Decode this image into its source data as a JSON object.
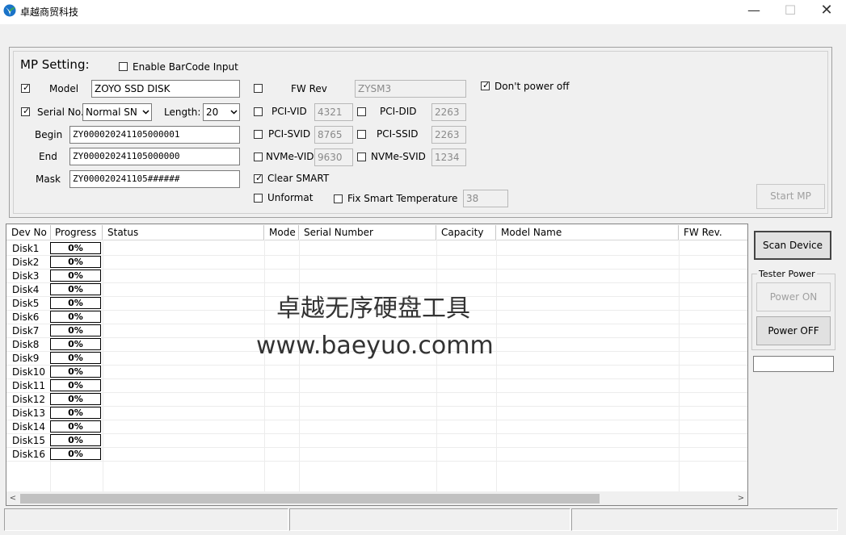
{
  "window": {
    "title": "卓越商贸科技",
    "minimize_glyph": "—",
    "maximize_glyph": "☐",
    "close_glyph": "✕",
    "icon": "app-logo-icon"
  },
  "mp_setting": {
    "label": "MP Setting:",
    "enable_barcode": {
      "label": "Enable BarCode Input",
      "checked": false
    },
    "model": {
      "label": "Model",
      "checked": true,
      "value": "ZOYO SSD DISK"
    },
    "serial": {
      "label": "Serial No.",
      "checked": true,
      "mode": "Normal SN",
      "length_label": "Length:",
      "length": "20"
    },
    "begin": {
      "label": "Begin",
      "value": "ZY000020241105000001"
    },
    "end": {
      "label": "End",
      "value": "ZY000020241105000000"
    },
    "mask": {
      "label": "Mask",
      "value": "ZY000020241105######"
    },
    "fw_rev": {
      "label": "FW Rev",
      "checked": false,
      "value": "ZYSM3"
    },
    "pci_vid": {
      "label": "PCI-VID",
      "checked": false,
      "value": "4321"
    },
    "pci_did": {
      "label": "PCI-DID",
      "checked": false,
      "value": "2263"
    },
    "pci_svid": {
      "label": "PCI-SVID",
      "checked": false,
      "value": "8765"
    },
    "pci_ssid": {
      "label": "PCI-SSID",
      "checked": false,
      "value": "2263"
    },
    "nvme_vid": {
      "label": "NVMe-VID",
      "checked": false,
      "value": "9630"
    },
    "nvme_svid": {
      "label": "NVMe-SVID",
      "checked": false,
      "value": "1234"
    },
    "clear_smart": {
      "label": "Clear SMART",
      "checked": true
    },
    "unformat": {
      "label": "Unformat",
      "checked": false
    },
    "fix_smart_temp": {
      "label": "Fix Smart Temperature",
      "checked": false,
      "value": "38"
    },
    "dont_power_off": {
      "label": "Don't power off",
      "checked": true
    },
    "start_mp": "Start MP"
  },
  "device_list": {
    "columns": [
      "Dev No",
      "Progress",
      "Status",
      "Mode",
      "Serial Number",
      "Capacity",
      "Model Name",
      "FW Rev."
    ],
    "rows": [
      {
        "dev": "Disk1",
        "progress": "0%"
      },
      {
        "dev": "Disk2",
        "progress": "0%"
      },
      {
        "dev": "Disk3",
        "progress": "0%"
      },
      {
        "dev": "Disk4",
        "progress": "0%"
      },
      {
        "dev": "Disk5",
        "progress": "0%"
      },
      {
        "dev": "Disk6",
        "progress": "0%"
      },
      {
        "dev": "Disk7",
        "progress": "0%"
      },
      {
        "dev": "Disk8",
        "progress": "0%"
      },
      {
        "dev": "Disk9",
        "progress": "0%"
      },
      {
        "dev": "Disk10",
        "progress": "0%"
      },
      {
        "dev": "Disk11",
        "progress": "0%"
      },
      {
        "dev": "Disk12",
        "progress": "0%"
      },
      {
        "dev": "Disk13",
        "progress": "0%"
      },
      {
        "dev": "Disk14",
        "progress": "0%"
      },
      {
        "dev": "Disk15",
        "progress": "0%"
      },
      {
        "dev": "Disk16",
        "progress": "0%"
      }
    ],
    "watermark_cn": "卓越无序硬盘工具",
    "watermark_url": "www.baeyuo.comm",
    "scroll_left": "<",
    "scroll_right": ">"
  },
  "side_panel": {
    "scan_device": "Scan Device",
    "tester_power_label": "Tester Power",
    "power_on": "Power ON",
    "power_off": "Power OFF",
    "status_value": ""
  },
  "colors": {
    "titlebar": "#ffffff",
    "window_bg": "#f0f0f0",
    "list_bg": "#ffffff",
    "logo_green": "#3aa757",
    "logo_blue": "#1a73c8"
  }
}
